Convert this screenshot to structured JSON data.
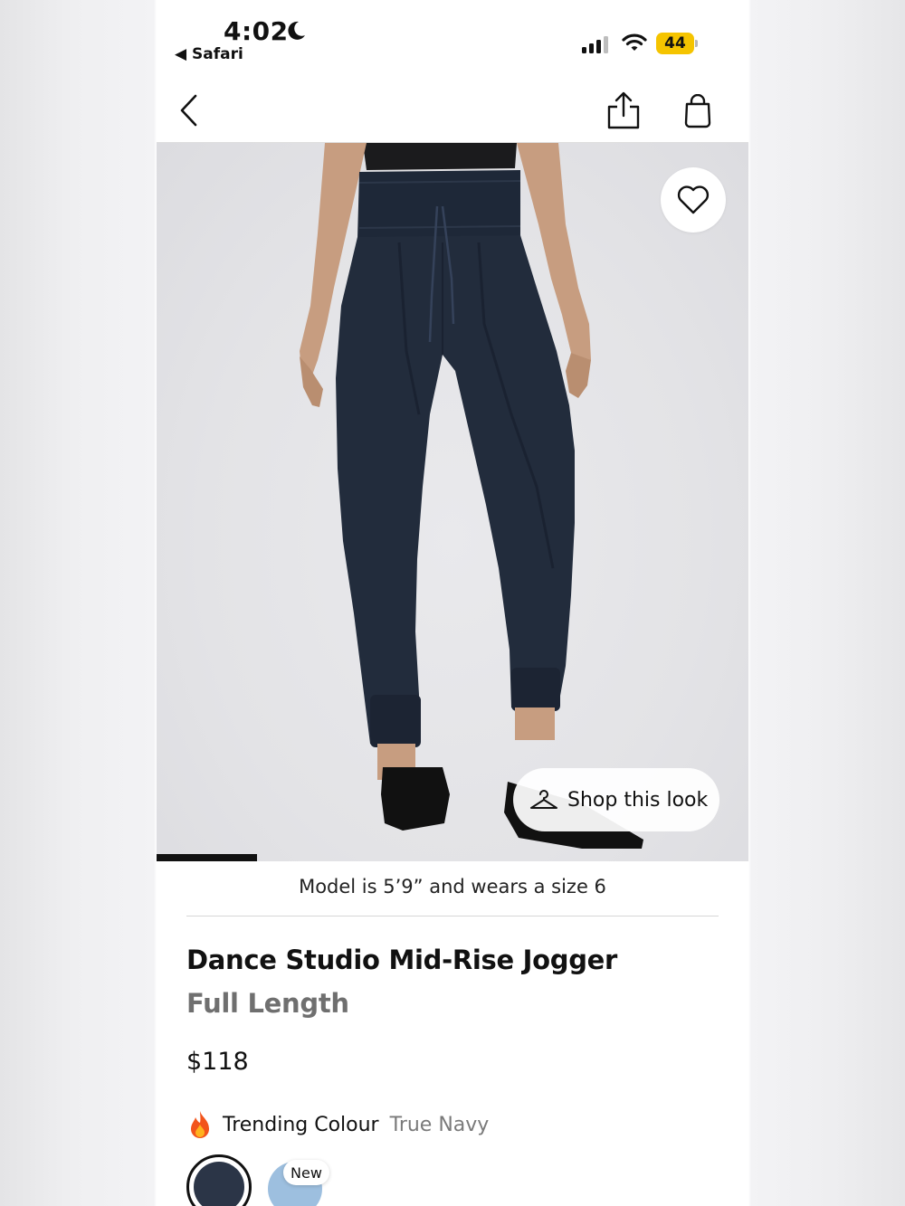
{
  "status_bar": {
    "time": "4:02",
    "back_app": "◀ Safari",
    "battery": "44",
    "battery_color": "#f5c400"
  },
  "nav": {
    "back_icon": "chevron-left-icon",
    "share_icon": "share-icon",
    "bag_icon": "shopping-bag-icon"
  },
  "hero": {
    "favorite_icon": "heart-icon",
    "shop_look_label": "Shop this look",
    "carousel_progress": 0.17
  },
  "product": {
    "model_note": "Model is 5’9” and wears a size 6",
    "name": "Dance Studio Mid-Rise Jogger",
    "subtitle": "Full Length",
    "price": "$118",
    "trending_label": "Trending Colour",
    "trending_value": "True Navy",
    "swatches": [
      {
        "color": "#2b3547",
        "selected": true
      },
      {
        "color": "#9dbfdf",
        "selected": false,
        "badge": "New"
      }
    ]
  }
}
